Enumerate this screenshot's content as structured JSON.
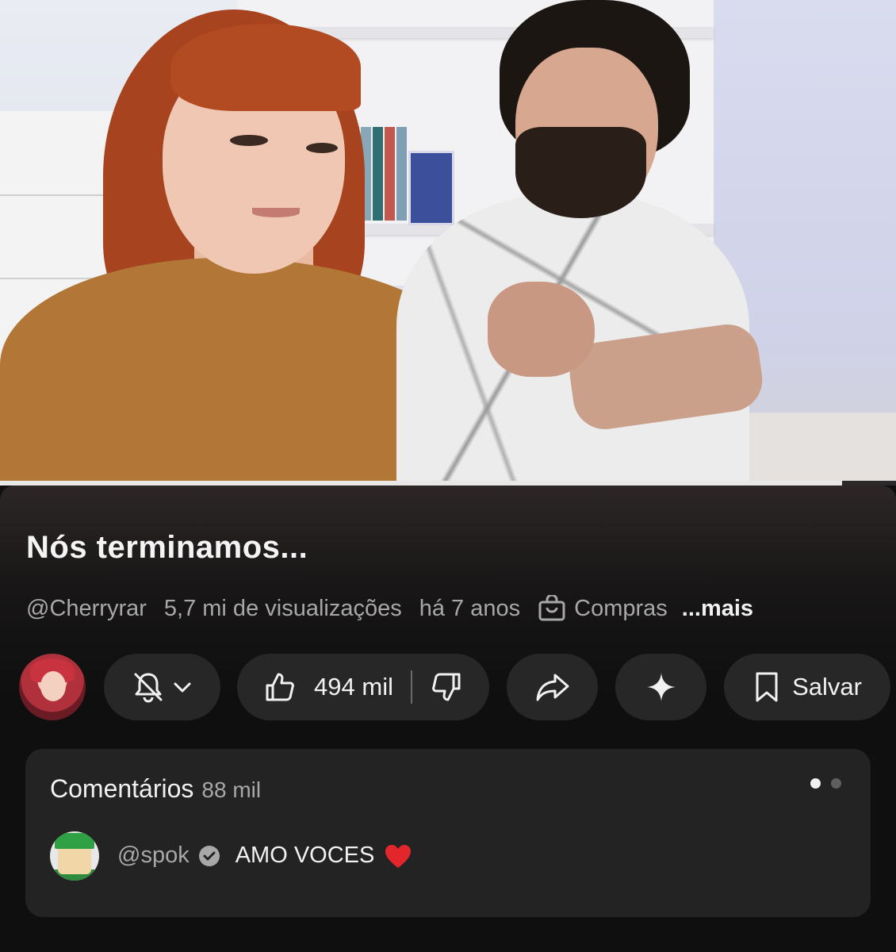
{
  "video": {
    "progress_fraction": 0.94
  },
  "info": {
    "title": "Nós terminamos...",
    "channel": "@Cherryrar",
    "views": "5,7 mi de visualizações",
    "age": "há 7 anos",
    "shop_label": "Compras",
    "more_label": "...mais"
  },
  "actions": {
    "likes": "494 mil",
    "save_label": "Salvar",
    "icons": [
      "bell-off-icon",
      "chevron-down-icon",
      "thumbs-up-icon",
      "thumbs-down-icon",
      "share-icon",
      "sparkle-icon",
      "bookmark-icon"
    ]
  },
  "comments": {
    "title": "Comentários",
    "count": "88 mil",
    "top": {
      "user": "@spok",
      "text": "AMO VOCES",
      "verified": true
    }
  },
  "colors": {
    "background": "#0f0f0f",
    "pill": "#272727",
    "card": "#232323",
    "muted_text": "#a8a8a8",
    "heart": "#e3262b"
  }
}
